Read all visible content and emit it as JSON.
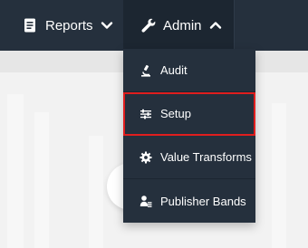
{
  "nav": {
    "reports_label": "Reports",
    "admin_label": "Admin",
    "reports_icon": "report-document-icon",
    "admin_icon": "wrench-icon"
  },
  "admin_menu": {
    "items": [
      {
        "label": "Audit",
        "icon": "microscope-icon"
      },
      {
        "label": "Setup",
        "icon": "sliders-icon",
        "highlighted": true
      },
      {
        "label": "Value Transforms",
        "icon": "gear-icon"
      },
      {
        "label": "Publisher Bands",
        "icon": "user-bands-icon"
      }
    ]
  },
  "colors": {
    "nav_bg": "#25303d",
    "highlight": "#e01e1e"
  }
}
